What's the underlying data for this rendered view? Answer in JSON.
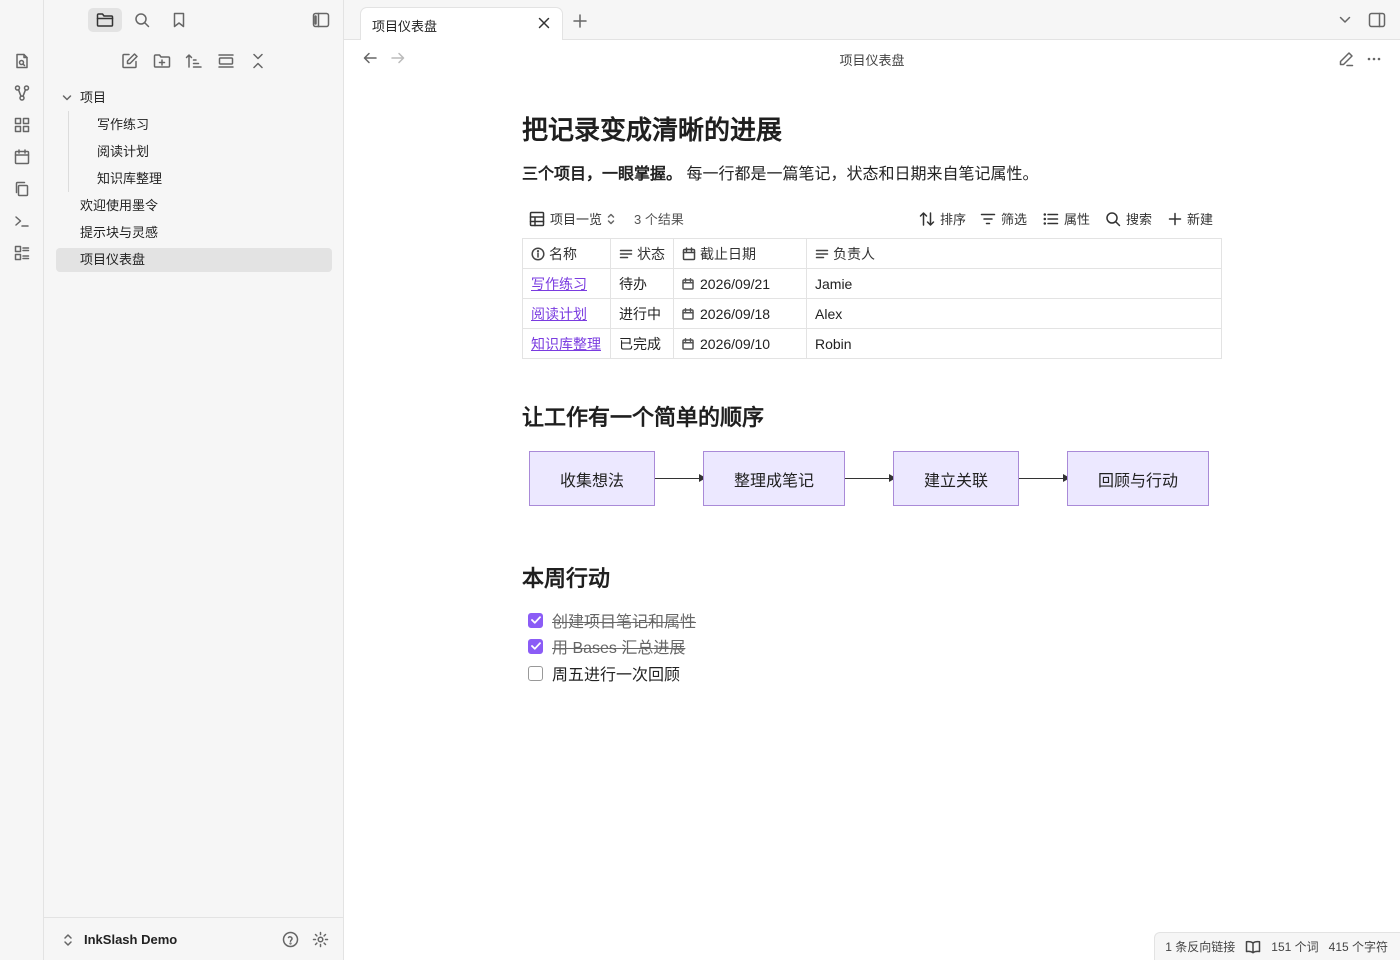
{
  "tab": {
    "title": "项目仪表盘"
  },
  "view": {
    "title": "项目仪表盘"
  },
  "file_tree": {
    "folder": "项目",
    "children": [
      "写作练习",
      "阅读计划",
      "知识库整理"
    ],
    "files": [
      "欢迎使用墨令",
      "提示块与灵感",
      "项目仪表盘"
    ],
    "active": "项目仪表盘"
  },
  "vault": {
    "name": "InkSlash Demo"
  },
  "note": {
    "h1": "把记录变成清晰的进展",
    "intro_bold": "三个项目，一眼掌握。",
    "intro_rest": "每一行都是一篇笔记，状态和日期来自笔记属性。",
    "h2_flow": "让工作有一个简单的顺序",
    "h2_tasks": "本周行动"
  },
  "base": {
    "view_name": "项目一览",
    "result_count": "3 个结果",
    "actions": {
      "sort": "排序",
      "filter": "筛选",
      "properties": "属性",
      "search": "搜索",
      "new": "新建"
    },
    "columns": [
      "名称",
      "状态",
      "截止日期",
      "负责人"
    ],
    "rows": [
      {
        "name": "写作练习",
        "status": "待办",
        "due": "2026/09/21",
        "owner": "Jamie"
      },
      {
        "name": "阅读计划",
        "status": "进行中",
        "due": "2026/09/18",
        "owner": "Alex"
      },
      {
        "name": "知识库整理",
        "status": "已完成",
        "due": "2026/09/10",
        "owner": "Robin"
      }
    ]
  },
  "flow": {
    "steps": [
      "收集想法",
      "整理成笔记",
      "建立关联",
      "回顾与行动"
    ]
  },
  "tasks": [
    {
      "text": "创建项目笔记和属性",
      "done": true
    },
    {
      "text": "用 Bases 汇总进展",
      "done": true
    },
    {
      "text": "周五进行一次回顾",
      "done": false
    }
  ],
  "status": {
    "backlinks": "1 条反向链接",
    "words": "151 个词",
    "chars": "415 个字符"
  },
  "colors": {
    "accent": "#8b5cf6",
    "flow_fill": "#ece8ff",
    "flow_border": "#a98ad8",
    "link": "#7a3ce0"
  },
  "icons": {
    "ribbon": [
      "daily-note-icon",
      "graph-icon",
      "canvas-icon",
      "calendar-icon",
      "copy-icon",
      "terminal-icon",
      "template-icon"
    ],
    "sidebar_tabs": [
      "folder-icon",
      "search-icon",
      "bookmark-icon"
    ]
  }
}
